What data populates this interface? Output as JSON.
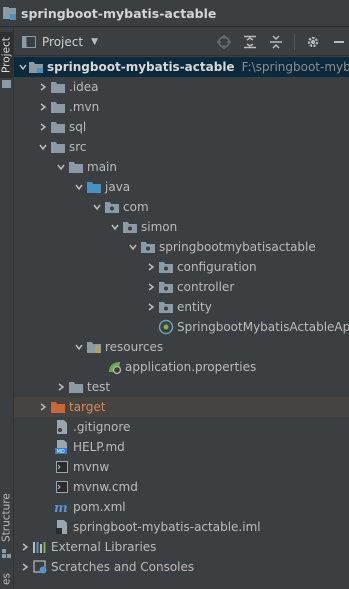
{
  "window": {
    "project_title": "springboot-mybatis-actable"
  },
  "side_tabs": {
    "project": "Project",
    "structure": "Structure",
    "favorites": "es"
  },
  "toolbar": {
    "view_label": "Project"
  },
  "tree": {
    "root": {
      "label": "springboot-mybatis-actable",
      "path": "F:\\springboot-mybati"
    },
    "idea": ".idea",
    "mvn": ".mvn",
    "sql": "sql",
    "src": "src",
    "main": "main",
    "java": "java",
    "com": "com",
    "simon": "simon",
    "pkg": "springbootmybatisactable",
    "configuration": "configuration",
    "controller": "controller",
    "entity": "entity",
    "app_class": "SpringbootMybatisActableAp",
    "resources": "resources",
    "app_props": "application.properties",
    "test": "test",
    "target": "target",
    "gitignore": ".gitignore",
    "help": "HELP.md",
    "mvnw": "mvnw",
    "mvnw_cmd": "mvnw.cmd",
    "pom": "pom.xml",
    "iml": "springboot-mybatis-actable.iml",
    "ext_libs": "External Libraries",
    "scratches": "Scratches and Consoles"
  },
  "colors": {
    "background": "#3c3f41",
    "selection": "#0d293e",
    "highlight_row": "#474341",
    "folder": "#8c9aa5",
    "source_folder": "#4a90c0",
    "excluded_folder": "#c7673a",
    "target_text": "#d48a5a"
  }
}
